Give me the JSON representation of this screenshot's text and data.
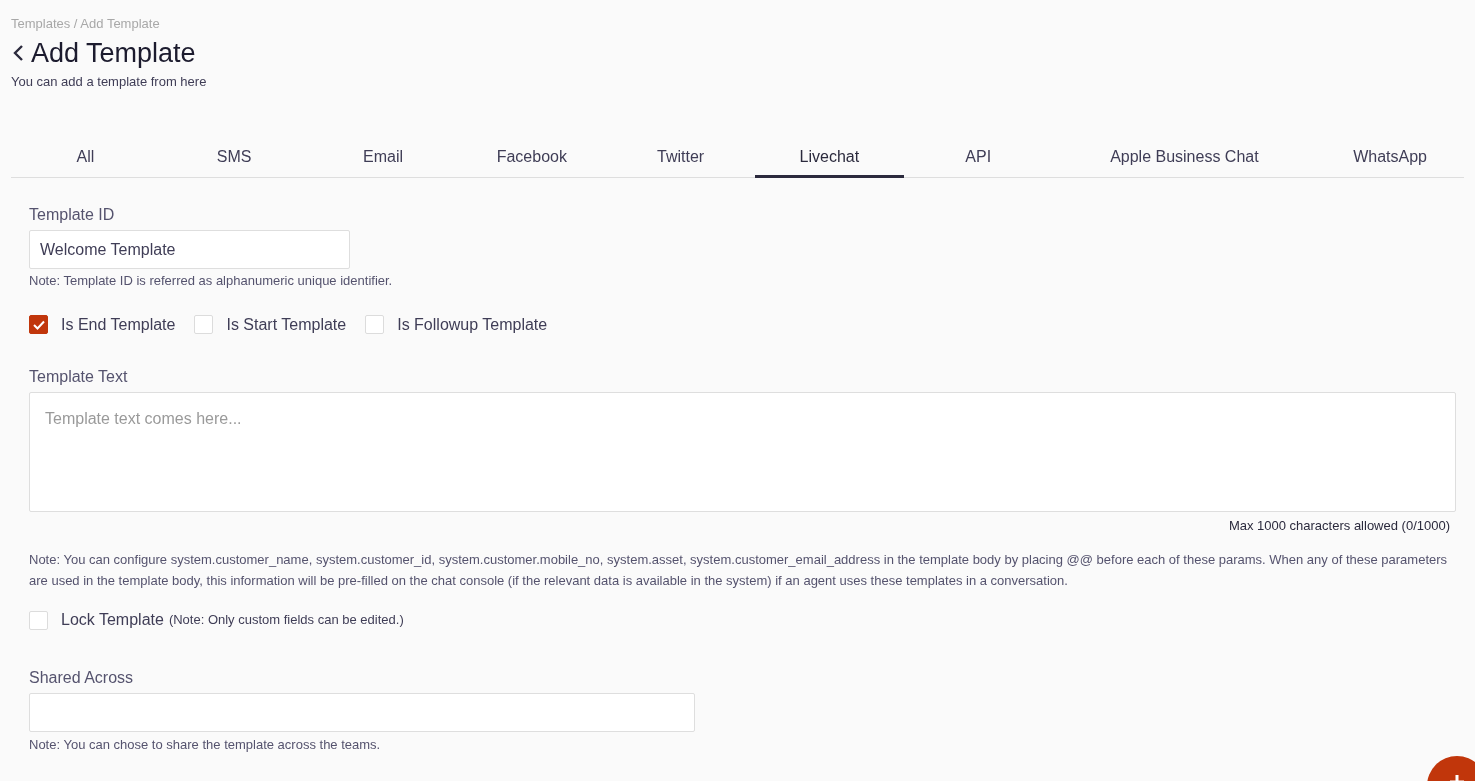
{
  "breadcrumb": "Templates / Add Template",
  "title": "Add Template",
  "subtitle": "You can add a template from here",
  "tabs": [
    {
      "label": "All",
      "selected": false
    },
    {
      "label": "SMS",
      "selected": false
    },
    {
      "label": "Email",
      "selected": false
    },
    {
      "label": "Facebook",
      "selected": false
    },
    {
      "label": "Twitter",
      "selected": false
    },
    {
      "label": "Livechat",
      "selected": true
    },
    {
      "label": "API",
      "selected": false
    },
    {
      "label": "Apple Business Chat",
      "selected": false
    },
    {
      "label": "WhatsApp",
      "selected": false
    }
  ],
  "template_id": {
    "label": "Template ID",
    "value": "Welcome Template",
    "note": "Note: Template ID is referred as alphanumeric unique identifier."
  },
  "options": [
    {
      "label": "Is End Template",
      "checked": true
    },
    {
      "label": "Is Start Template",
      "checked": false
    },
    {
      "label": "Is Followup Template",
      "checked": false
    }
  ],
  "template_text": {
    "label": "Template Text",
    "placeholder": "Template text comes here...",
    "counter": "Max 1000 characters allowed (0/1000)",
    "note": "Note: You can configure system.customer_name, system.customer_id, system.customer.mobile_no, system.asset, system.customer_email_address in the template body by placing @@ before each of these params. When any of these parameters are used in the template body, this information will be pre-filled on the chat console (if the relevant data is available in the system) if an agent uses these templates in a conversation."
  },
  "lock": {
    "label": "Lock Template",
    "note": "(Note: Only custom fields can be edited.)",
    "checked": false
  },
  "shared_across": {
    "label": "Shared Across",
    "note": "Note: You can chose to share the template across the teams."
  }
}
